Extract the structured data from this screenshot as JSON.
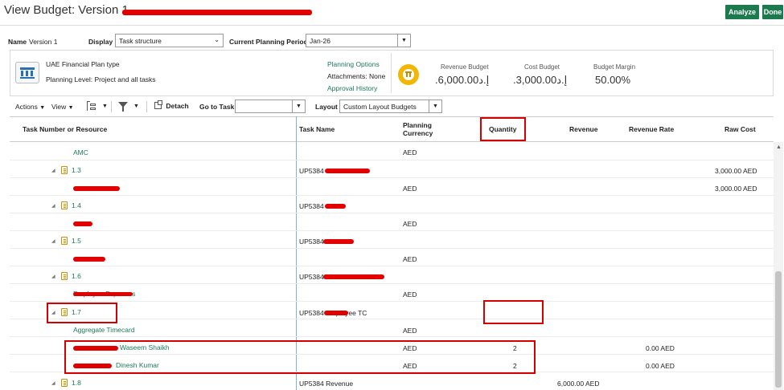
{
  "page_title": "View Budget: Version 1",
  "buttons": {
    "analyze": "Analyze",
    "done": "Done"
  },
  "filters": {
    "name_label": "Name",
    "name_value": "Version 1",
    "display_label": "Display",
    "display_value": "Task structure",
    "period_label": "Current Planning Period",
    "period_value": "Jan-26"
  },
  "summary": {
    "plan_type": "UAE Financial Plan type",
    "planning_level": "Planning Level: Project and all tasks",
    "planning_options": "Planning Options",
    "attachments_label": "Attachments:",
    "attachments_value": "None",
    "approval_history": "Approval History",
    "revenue_budget_label": "Revenue Budget",
    "revenue_budget_value": ".إ.د6,000.00",
    "cost_budget_label": "Cost Budget",
    "cost_budget_value": ".إ.د3,000.00",
    "budget_margin_label": "Budget Margin",
    "budget_margin_value": "50.00%"
  },
  "toolbar": {
    "actions": "Actions",
    "view": "View",
    "detach": "Detach",
    "goto_task_label": "Go to Task",
    "goto_task_value": "",
    "layout_label": "Layout",
    "layout_value": "Custom Layout Budgets"
  },
  "table": {
    "headers": {
      "task": "Task Number or Resource",
      "task_name": "Task Name",
      "currency": "Planning Currency",
      "quantity": "Quantity",
      "revenue": "Revenue",
      "revenue_rate": "Revenue Rate",
      "raw_cost": "Raw Cost"
    },
    "rows": [
      {
        "label": "AMC",
        "task_name": "",
        "currency": "AED",
        "quantity": "",
        "revenue": "",
        "rate": "",
        "raw_cost": ""
      },
      {
        "label": "1.3",
        "task_name": "UP5384",
        "currency": "",
        "quantity": "",
        "revenue": "",
        "rate": "",
        "raw_cost": "3,000.00 AED"
      },
      {
        "label": "",
        "task_name": "",
        "currency": "AED",
        "quantity": "",
        "revenue": "",
        "rate": "",
        "raw_cost": "3,000.00 AED"
      },
      {
        "label": "1.4",
        "task_name": "UP5384",
        "currency": "",
        "quantity": "",
        "revenue": "",
        "rate": "",
        "raw_cost": ""
      },
      {
        "label": "",
        "task_name": "",
        "currency": "AED",
        "quantity": "",
        "revenue": "",
        "rate": "",
        "raw_cost": ""
      },
      {
        "label": "1.5",
        "task_name": "UP5384",
        "currency": "",
        "quantity": "",
        "revenue": "",
        "rate": "",
        "raw_cost": ""
      },
      {
        "label": "",
        "task_name": "",
        "currency": "AED",
        "quantity": "",
        "revenue": "",
        "rate": "",
        "raw_cost": ""
      },
      {
        "label": "1.6",
        "task_name": "UP5384",
        "currency": "",
        "quantity": "",
        "revenue": "",
        "rate": "",
        "raw_cost": ""
      },
      {
        "label": "Employee Expenses",
        "task_name": "",
        "currency": "AED",
        "quantity": "",
        "revenue": "",
        "rate": "",
        "raw_cost": ""
      },
      {
        "label": "1.7",
        "task_name": "UP5384 Employee TC",
        "currency": "",
        "quantity": "",
        "revenue": "",
        "rate": "",
        "raw_cost": ""
      },
      {
        "label": "Aggregate Timecard",
        "task_name": "",
        "currency": "AED",
        "quantity": "",
        "revenue": "",
        "rate": "",
        "raw_cost": ""
      },
      {
        "label": "Waseem Shaikh",
        "task_name": "",
        "currency": "AED",
        "quantity": "2",
        "revenue": "",
        "rate": "0.00 AED",
        "raw_cost": ""
      },
      {
        "label": "Dinesh Kumar",
        "task_name": "",
        "currency": "AED",
        "quantity": "2",
        "revenue": "",
        "rate": "0.00 AED",
        "raw_cost": ""
      },
      {
        "label": "1.8",
        "task_name": "UP5384 Revenue",
        "currency": "",
        "quantity": "",
        "revenue": "6,000.00 AED",
        "rate": "",
        "raw_cost": ""
      }
    ]
  }
}
